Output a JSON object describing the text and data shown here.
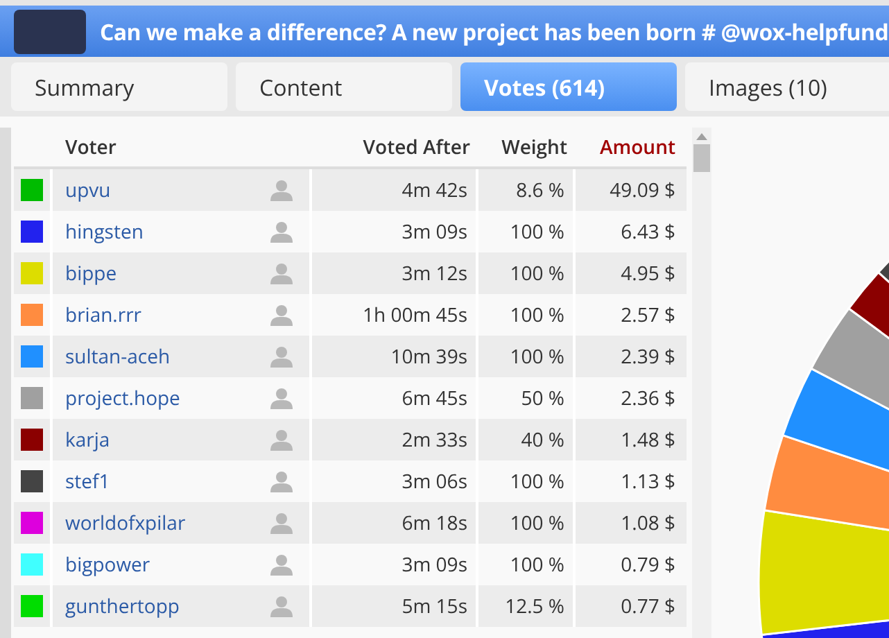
{
  "header": {
    "title": "Can we make a difference? A new project has been born # @wox-helpfund"
  },
  "tabs": [
    {
      "label": "Summary",
      "selected": false
    },
    {
      "label": "Content",
      "selected": false
    },
    {
      "label": "Votes (614)",
      "selected": true
    },
    {
      "label": "Images (10)",
      "selected": false
    }
  ],
  "table": {
    "columns": [
      "Voter",
      "Voted After",
      "Weight",
      "Amount"
    ],
    "rows": [
      {
        "color": "#00bb00",
        "voter": "upvu",
        "voted_after": "4m 42s",
        "weight": "8.6 %",
        "amount": "49.09 $"
      },
      {
        "color": "#2222ee",
        "voter": "hingsten",
        "voted_after": "3m 09s",
        "weight": "100 %",
        "amount": "6.43 $"
      },
      {
        "color": "#dddd00",
        "voter": "bippe",
        "voted_after": "3m 12s",
        "weight": "100 %",
        "amount": "4.95 $"
      },
      {
        "color": "#ff8c40",
        "voter": "brian.rrr",
        "voted_after": "1h 00m 45s",
        "weight": "100 %",
        "amount": "2.57 $"
      },
      {
        "color": "#2090ff",
        "voter": "sultan-aceh",
        "voted_after": "10m 39s",
        "weight": "100 %",
        "amount": "2.39 $"
      },
      {
        "color": "#a0a0a0",
        "voter": "project.hope",
        "voted_after": "6m 45s",
        "weight": "50 %",
        "amount": "2.36 $"
      },
      {
        "color": "#8b0000",
        "voter": "karja",
        "voted_after": "2m 33s",
        "weight": "40 %",
        "amount": "1.48 $"
      },
      {
        "color": "#444444",
        "voter": "stef1",
        "voted_after": "3m 06s",
        "weight": "100 %",
        "amount": "1.13 $"
      },
      {
        "color": "#dd00dd",
        "voter": "worldofxpilar",
        "voted_after": "6m 18s",
        "weight": "100 %",
        "amount": "1.08 $"
      },
      {
        "color": "#40ffff",
        "voter": "bigpower",
        "voted_after": "3m 09s",
        "weight": "100 %",
        "amount": "0.79 $"
      },
      {
        "color": "#00dd00",
        "voter": "gunthertopp",
        "voted_after": "5m 15s",
        "weight": "12.5 %",
        "amount": "0.77 $"
      }
    ]
  }
}
